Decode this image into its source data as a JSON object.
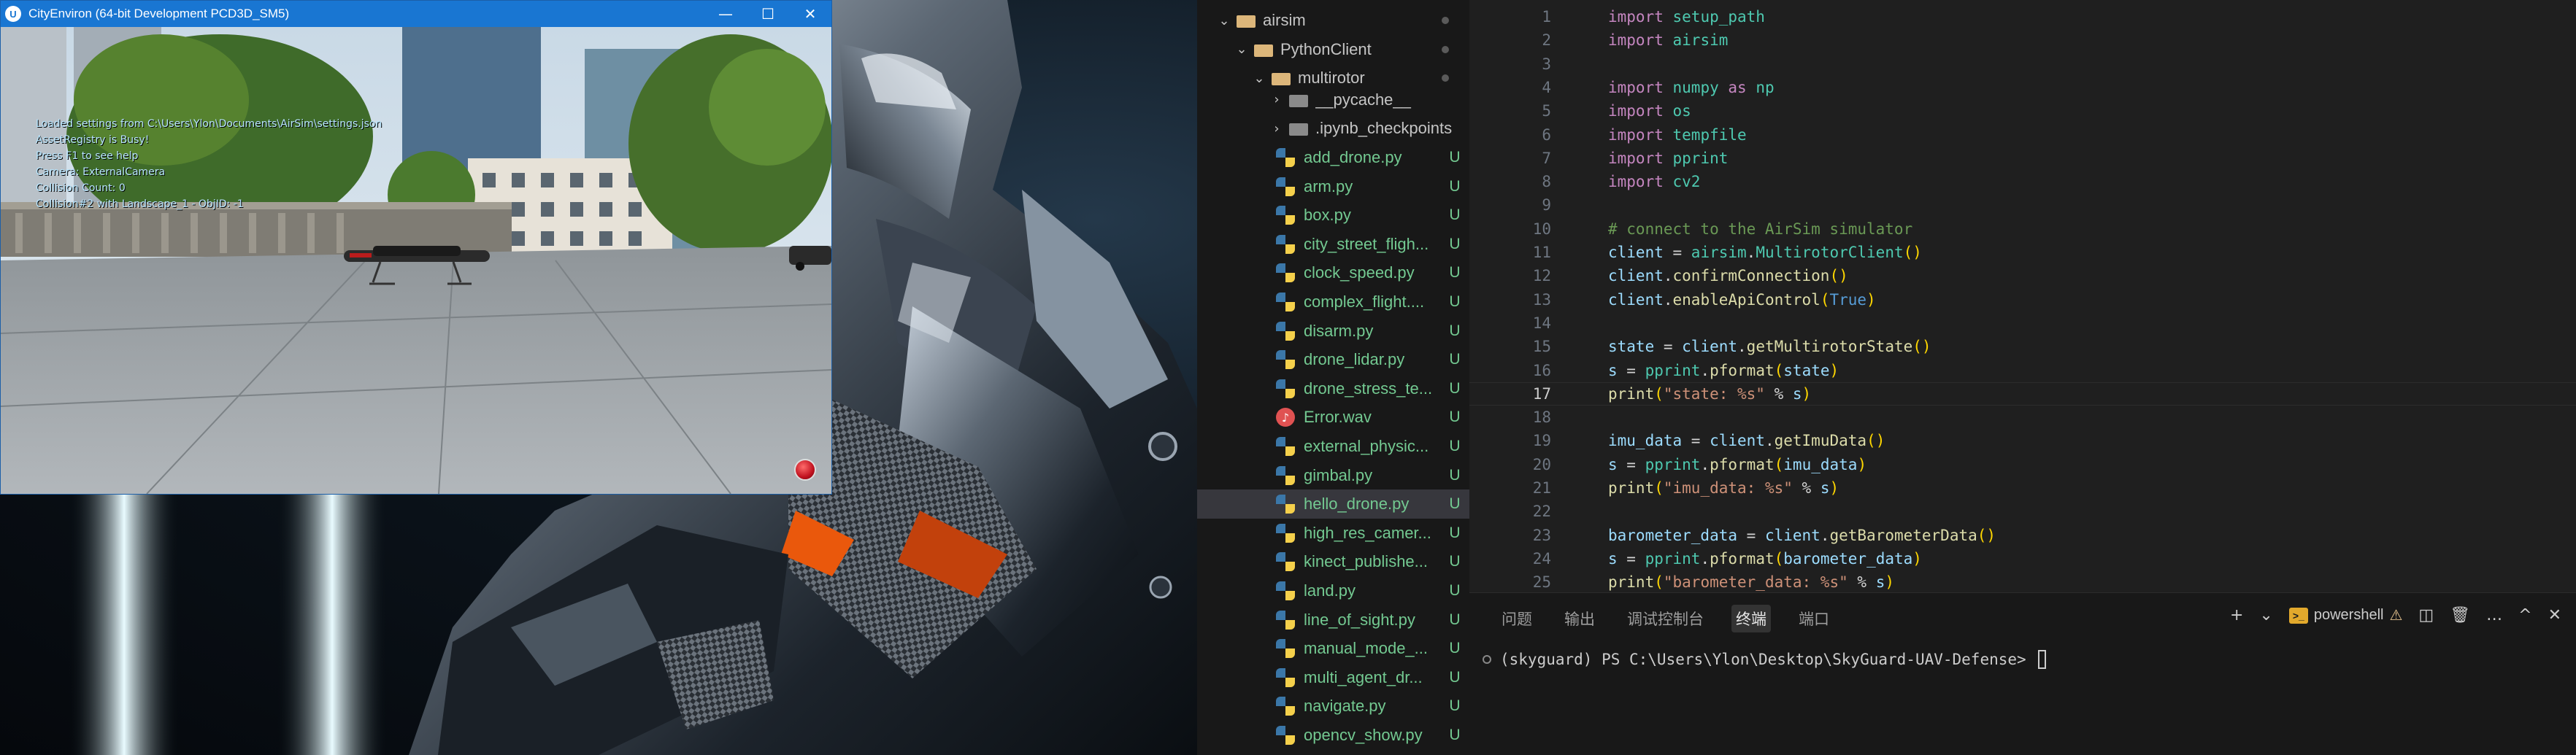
{
  "game_window": {
    "title": "CityEnviron (64-bit Development PCD3D_SM5)",
    "logo": "U",
    "controls": {
      "minimize": "—",
      "maximize": "☐",
      "close": "✕"
    },
    "hud_lines": [
      "Loaded settings from C:\\Users\\Ylon\\Documents\\AirSim\\settings.json",
      "AssetRegistry is Busy!",
      "Press F1 to see help",
      "Camera: ExternalCamera",
      "Collision Count: 0",
      "Collision#2 with Landscape_1 - ObjID: -1"
    ],
    "icons": {
      "record": "record-icon"
    }
  },
  "explorer": {
    "folders": [
      {
        "label": "airsim",
        "state": "open"
      },
      {
        "label": "PythonClient",
        "state": "open"
      },
      {
        "label": "multirotor",
        "state": "open"
      }
    ],
    "subfolders": [
      {
        "label": "__pycache__"
      },
      {
        "label": ".ipynb_checkpoints"
      }
    ],
    "files": [
      {
        "label": "add_drone.py",
        "badge": "U",
        "type": "py"
      },
      {
        "label": "arm.py",
        "badge": "U",
        "type": "py"
      },
      {
        "label": "box.py",
        "badge": "U",
        "type": "py"
      },
      {
        "label": "city_street_fligh...",
        "badge": "U",
        "type": "py"
      },
      {
        "label": "clock_speed.py",
        "badge": "U",
        "type": "py"
      },
      {
        "label": "complex_flight....",
        "badge": "U",
        "type": "py"
      },
      {
        "label": "disarm.py",
        "badge": "U",
        "type": "py"
      },
      {
        "label": "drone_lidar.py",
        "badge": "U",
        "type": "py"
      },
      {
        "label": "drone_stress_te...",
        "badge": "U",
        "type": "py"
      },
      {
        "label": "Error.wav",
        "badge": "U",
        "type": "wav"
      },
      {
        "label": "external_physic...",
        "badge": "U",
        "type": "py"
      },
      {
        "label": "gimbal.py",
        "badge": "U",
        "type": "py"
      },
      {
        "label": "hello_drone.py",
        "badge": "U",
        "type": "py",
        "selected": true
      },
      {
        "label": "high_res_camer...",
        "badge": "U",
        "type": "py"
      },
      {
        "label": "kinect_publishe...",
        "badge": "U",
        "type": "py"
      },
      {
        "label": "land.py",
        "badge": "U",
        "type": "py"
      },
      {
        "label": "line_of_sight.py",
        "badge": "U",
        "type": "py"
      },
      {
        "label": "manual_mode_...",
        "badge": "U",
        "type": "py"
      },
      {
        "label": "multi_agent_dr...",
        "badge": "U",
        "type": "py"
      },
      {
        "label": "navigate.py",
        "badge": "U",
        "type": "py"
      },
      {
        "label": "opencv_show.py",
        "badge": "U",
        "type": "py"
      }
    ]
  },
  "editor": {
    "current_line": 17,
    "lines": [
      {
        "n": "1",
        "tokens": [
          [
            "kw",
            "import"
          ],
          [
            "op",
            " "
          ],
          [
            "mod",
            "setup_path"
          ]
        ]
      },
      {
        "n": "2",
        "tokens": [
          [
            "kw",
            "import"
          ],
          [
            "op",
            " "
          ],
          [
            "mod",
            "airsim"
          ]
        ]
      },
      {
        "n": "3",
        "tokens": []
      },
      {
        "n": "4",
        "tokens": [
          [
            "kw",
            "import"
          ],
          [
            "op",
            " "
          ],
          [
            "mod",
            "numpy"
          ],
          [
            "op",
            " "
          ],
          [
            "kw",
            "as"
          ],
          [
            "op",
            " "
          ],
          [
            "mod",
            "np"
          ]
        ]
      },
      {
        "n": "5",
        "tokens": [
          [
            "kw",
            "import"
          ],
          [
            "op",
            " "
          ],
          [
            "mod",
            "os"
          ]
        ]
      },
      {
        "n": "6",
        "tokens": [
          [
            "kw",
            "import"
          ],
          [
            "op",
            " "
          ],
          [
            "mod",
            "tempfile"
          ]
        ]
      },
      {
        "n": "7",
        "tokens": [
          [
            "kw",
            "import"
          ],
          [
            "op",
            " "
          ],
          [
            "mod",
            "pprint"
          ]
        ]
      },
      {
        "n": "8",
        "tokens": [
          [
            "kw",
            "import"
          ],
          [
            "op",
            " "
          ],
          [
            "mod",
            "cv2"
          ]
        ]
      },
      {
        "n": "9",
        "tokens": []
      },
      {
        "n": "10",
        "tokens": [
          [
            "cmt",
            "# connect to the AirSim simulator"
          ]
        ]
      },
      {
        "n": "11",
        "tokens": [
          [
            "id",
            "client"
          ],
          [
            "op",
            " = "
          ],
          [
            "mod",
            "airsim"
          ],
          [
            "op",
            "."
          ],
          [
            "mod",
            "MultirotorClient"
          ],
          [
            "par",
            "()"
          ]
        ]
      },
      {
        "n": "12",
        "tokens": [
          [
            "id",
            "client"
          ],
          [
            "op",
            "."
          ],
          [
            "fn",
            "confirmConnection"
          ],
          [
            "par",
            "()"
          ]
        ]
      },
      {
        "n": "13",
        "tokens": [
          [
            "id",
            "client"
          ],
          [
            "op",
            "."
          ],
          [
            "fn",
            "enableApiControl"
          ],
          [
            "par",
            "("
          ],
          [
            "const",
            "True"
          ],
          [
            "par",
            ")"
          ]
        ]
      },
      {
        "n": "14",
        "tokens": []
      },
      {
        "n": "15",
        "tokens": [
          [
            "id",
            "state"
          ],
          [
            "op",
            " = "
          ],
          [
            "id",
            "client"
          ],
          [
            "op",
            "."
          ],
          [
            "fn",
            "getMultirotorState"
          ],
          [
            "par",
            "()"
          ]
        ]
      },
      {
        "n": "16",
        "tokens": [
          [
            "id",
            "s"
          ],
          [
            "op",
            " = "
          ],
          [
            "mod",
            "pprint"
          ],
          [
            "op",
            "."
          ],
          [
            "fn",
            "pformat"
          ],
          [
            "par",
            "("
          ],
          [
            "id",
            "state"
          ],
          [
            "par",
            ")"
          ]
        ]
      },
      {
        "n": "17",
        "tokens": [
          [
            "fn",
            "print"
          ],
          [
            "par",
            "("
          ],
          [
            "str",
            "\"state: %s\""
          ],
          [
            "op",
            " % "
          ],
          [
            "id",
            "s"
          ],
          [
            "par",
            ")"
          ]
        ]
      },
      {
        "n": "18",
        "tokens": []
      },
      {
        "n": "19",
        "tokens": [
          [
            "id",
            "imu_data"
          ],
          [
            "op",
            " = "
          ],
          [
            "id",
            "client"
          ],
          [
            "op",
            "."
          ],
          [
            "fn",
            "getImuData"
          ],
          [
            "par",
            "()"
          ]
        ]
      },
      {
        "n": "20",
        "tokens": [
          [
            "id",
            "s"
          ],
          [
            "op",
            " = "
          ],
          [
            "mod",
            "pprint"
          ],
          [
            "op",
            "."
          ],
          [
            "fn",
            "pformat"
          ],
          [
            "par",
            "("
          ],
          [
            "id",
            "imu_data"
          ],
          [
            "par",
            ")"
          ]
        ]
      },
      {
        "n": "21",
        "tokens": [
          [
            "fn",
            "print"
          ],
          [
            "par",
            "("
          ],
          [
            "str",
            "\"imu_data: %s\""
          ],
          [
            "op",
            " % "
          ],
          [
            "id",
            "s"
          ],
          [
            "par",
            ")"
          ]
        ]
      },
      {
        "n": "22",
        "tokens": []
      },
      {
        "n": "23",
        "tokens": [
          [
            "id",
            "barometer_data"
          ],
          [
            "op",
            " = "
          ],
          [
            "id",
            "client"
          ],
          [
            "op",
            "."
          ],
          [
            "fn",
            "getBarometerData"
          ],
          [
            "par",
            "()"
          ]
        ]
      },
      {
        "n": "24",
        "tokens": [
          [
            "id",
            "s"
          ],
          [
            "op",
            " = "
          ],
          [
            "mod",
            "pprint"
          ],
          [
            "op",
            "."
          ],
          [
            "fn",
            "pformat"
          ],
          [
            "par",
            "("
          ],
          [
            "id",
            "barometer_data"
          ],
          [
            "par",
            ")"
          ]
        ]
      },
      {
        "n": "25",
        "tokens": [
          [
            "fn",
            "print"
          ],
          [
            "par",
            "("
          ],
          [
            "str",
            "\"barometer_data: %s\""
          ],
          [
            "op",
            " % "
          ],
          [
            "id",
            "s"
          ],
          [
            "par",
            ")"
          ]
        ]
      }
    ]
  },
  "panel": {
    "tabs": [
      {
        "label": "问题",
        "active": false
      },
      {
        "label": "输出",
        "active": false
      },
      {
        "label": "调试控制台",
        "active": false
      },
      {
        "label": "终端",
        "active": true
      },
      {
        "label": "端口",
        "active": false
      }
    ],
    "terminal_name": "powershell",
    "ps_badge": ">_",
    "actions": {
      "add": "+",
      "dropdown": "⌄",
      "warning": "⚠",
      "split": "◫",
      "trash": "🗑",
      "more": "…",
      "maximize": "^",
      "close": "✕"
    },
    "prompt": "(skyguard) PS C:\\Users\\Ylon\\Desktop\\SkyGuard-UAV-Defense> "
  }
}
